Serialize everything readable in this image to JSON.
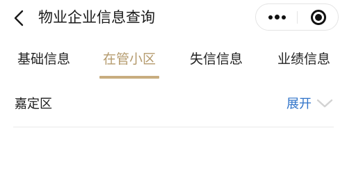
{
  "navbar": {
    "title": "物业企业信息查询"
  },
  "tabs": [
    {
      "label": "基础信息",
      "active": false
    },
    {
      "label": "在管小区",
      "active": true
    },
    {
      "label": "失信信息",
      "active": false
    },
    {
      "label": "业绩信息",
      "active": false
    }
  ],
  "region": {
    "name": "嘉定区",
    "expand_label": "展开"
  },
  "colors": {
    "accent_tab": "#b59b6e",
    "tab_underline": "#c8ad7f",
    "link": "#2f73c9"
  },
  "icons": [
    "back-arrow-icon",
    "more-dots-icon",
    "close-target-icon",
    "chevron-down-icon"
  ]
}
